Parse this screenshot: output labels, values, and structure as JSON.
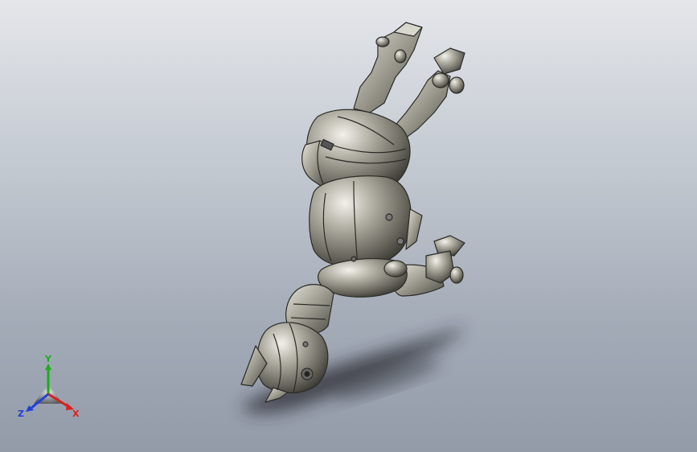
{
  "viewport": {
    "background_top": "#e4e6ea",
    "background_bottom": "#939ba9"
  },
  "model": {
    "body_color": "#8d8b80",
    "highlight_color": "#e8e7de",
    "edge_color": "#2b2b27",
    "shadow_color": "#2a2c33"
  },
  "triad": {
    "x_label": "X",
    "y_label": "Y",
    "z_label": "Z",
    "x_color": "#d92020",
    "y_color": "#18b018",
    "z_color": "#2040d8"
  }
}
